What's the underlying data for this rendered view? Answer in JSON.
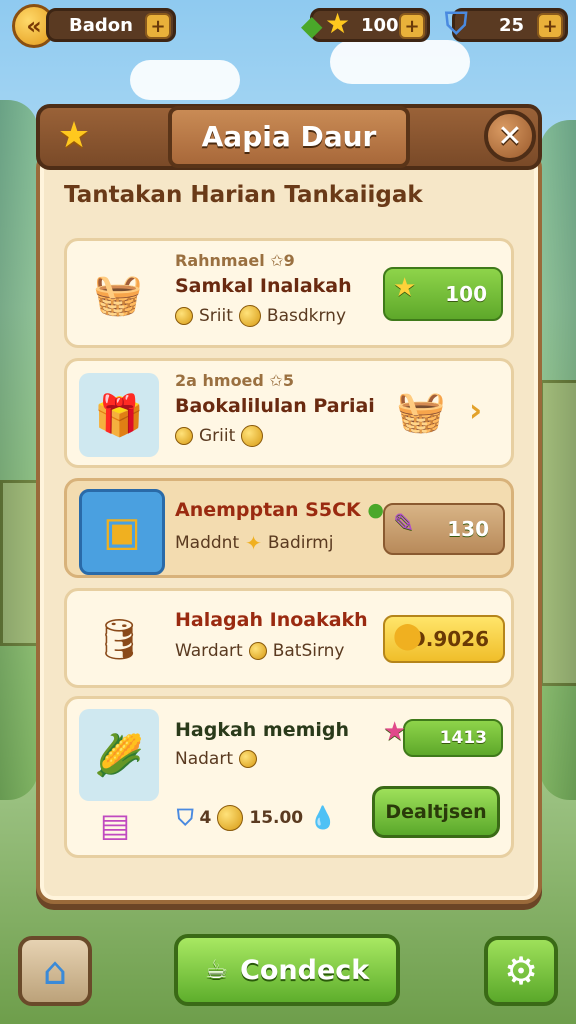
{
  "colors": {
    "accent_green": "#5ea82a",
    "wood": "#7a4a28",
    "parchment": "#f6e7c8",
    "title_brown": "#6a2a10"
  },
  "topbar": {
    "back_icon": "back-arrow-icon",
    "player_name": "Badon",
    "star_count": "100",
    "shield_count": "25"
  },
  "panel": {
    "title": "Aapia Daur",
    "subtitle": "Tantakan Harian  Tankaiigak"
  },
  "quests": [
    {
      "tag": "Rahnmael ✩9",
      "title": "Samkal Inalakah",
      "meta_a": "Sriit",
      "meta_b": "Basdkrny",
      "reward": "100",
      "icon": "wooden-basket-icon"
    },
    {
      "tag": "2a hmoed ✩5",
      "title": "Baokalilulan Pariai",
      "meta_a": "Griit",
      "icon": "gift-basket-icon",
      "reward_icon": "treasure-basket-icon"
    },
    {
      "tag": "",
      "title": "Anempptan S5CK",
      "meta_a": "Maddnt",
      "meta_b": "Badirmj",
      "reward": "130",
      "icon": "treasure-chest-icon"
    },
    {
      "tag": "",
      "title": "Halagah Inoakakh",
      "meta_a": "Wardart",
      "meta_b": "BatSirny",
      "reward": "D.9026",
      "icon": "barrel-icon"
    },
    {
      "tag": "",
      "title": "Hagkah memigh",
      "meta_a": "Nadart",
      "reward": "1413",
      "footer_value_a": "4",
      "footer_value_b": "15.00",
      "button": "Dealtjsen",
      "icon": "cornucopia-icon"
    }
  ],
  "bottom_nav": {
    "main_label": "Condeck"
  }
}
